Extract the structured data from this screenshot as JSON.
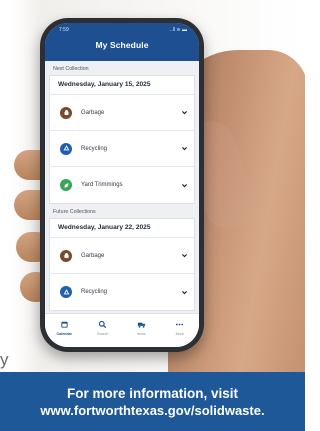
{
  "status": {
    "time": "7:59",
    "indicators": "..ll ≋ ▬"
  },
  "app": {
    "title": "My Schedule"
  },
  "next": {
    "label": "Next Collection",
    "date": "Wednesday, January 15, 2025",
    "items": [
      {
        "label": "Garbage",
        "icon": "garbage-bag-icon",
        "color": "#7a4a2a"
      },
      {
        "label": "Recycling",
        "icon": "recycle-icon",
        "color": "#1f5fb0"
      },
      {
        "label": "Yard Trimmings",
        "icon": "leaf-icon",
        "color": "#3aa556"
      }
    ]
  },
  "future": {
    "label": "Future Collections",
    "date": "Wednesday, January 22, 2025",
    "items": [
      {
        "label": "Garbage",
        "icon": "garbage-bag-icon",
        "color": "#7a4a2a"
      },
      {
        "label": "Recycling",
        "icon": "recycle-icon",
        "color": "#1f5fb0"
      }
    ]
  },
  "tabs": [
    {
      "label": "Calendar",
      "icon": "calendar-icon",
      "active": true
    },
    {
      "label": "Search",
      "icon": "search-icon",
      "active": false
    },
    {
      "label": "Items",
      "icon": "truck-icon",
      "active": false
    },
    {
      "label": "More",
      "icon": "more-dots-icon",
      "active": false
    }
  ],
  "banner": {
    "line1": "For more information, visit",
    "line2": "www.fortworthtexas.gov/solidwaste."
  },
  "edge_text": "y",
  "colors": {
    "brand_blue": "#1d4f91",
    "banner_blue": "#1f5899"
  }
}
